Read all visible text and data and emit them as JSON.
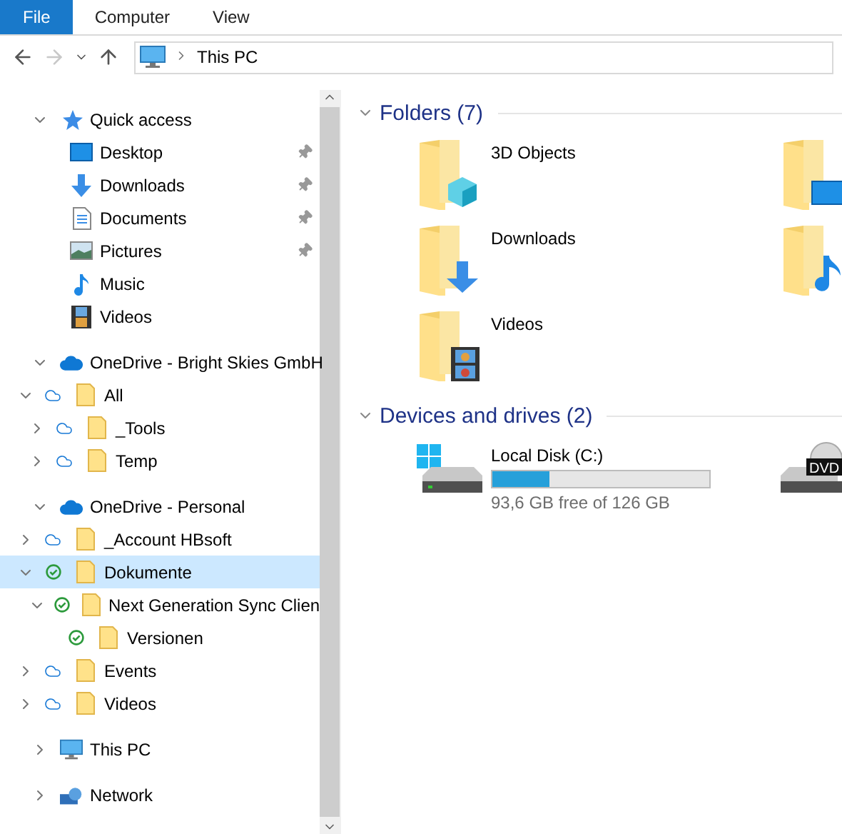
{
  "ribbon_tabs": [
    {
      "label": "File",
      "selected": true
    },
    {
      "label": "Computer",
      "selected": false
    },
    {
      "label": "View",
      "selected": false
    }
  ],
  "address": {
    "path": [
      "This PC"
    ]
  },
  "nav": [
    {
      "label": "Quick access",
      "kind": "star",
      "expanded": true,
      "selected": false,
      "children": [
        {
          "label": "Desktop",
          "kind": "desktop",
          "pinned": true,
          "selected": false
        },
        {
          "label": "Downloads",
          "kind": "download",
          "pinned": true,
          "selected": false
        },
        {
          "label": "Documents",
          "kind": "document",
          "pinned": true,
          "selected": false
        },
        {
          "label": "Pictures",
          "kind": "picture",
          "pinned": true,
          "selected": false
        },
        {
          "label": "Music",
          "kind": "music",
          "pinned": false,
          "selected": false
        },
        {
          "label": "Videos",
          "kind": "video",
          "pinned": false,
          "selected": false
        }
      ]
    },
    {
      "label": "OneDrive - Bright Skies GmbH",
      "kind": "onedrive",
      "expanded": true,
      "selected": false,
      "children": [
        {
          "label": "All",
          "kind": "cloud",
          "expanded": true,
          "selected": false,
          "children": [
            {
              "label": "_Tools",
              "kind": "cloud",
              "expanded": false,
              "selected": false
            },
            {
              "label": "Temp",
              "kind": "cloud",
              "expanded": false,
              "selected": false
            }
          ]
        }
      ]
    },
    {
      "label": "OneDrive - Personal",
      "kind": "onedrive",
      "expanded": true,
      "selected": false,
      "children": [
        {
          "label": "_Account HBsoft",
          "kind": "cloud",
          "expanded": false,
          "selected": false
        },
        {
          "label": "Dokumente",
          "kind": "synced",
          "expanded": true,
          "selected": true,
          "children": [
            {
              "label": "Next Generation Sync Clien",
              "kind": "synced",
              "expanded": true,
              "selected": false,
              "children": [
                {
                  "label": "Versionen",
                  "kind": "synced",
                  "selected": false
                }
              ]
            }
          ]
        },
        {
          "label": "Events",
          "kind": "cloud",
          "expanded": false,
          "selected": false
        },
        {
          "label": "Videos",
          "kind": "cloud",
          "expanded": false,
          "selected": false
        }
      ]
    },
    {
      "label": "This PC",
      "kind": "pc",
      "expanded": false,
      "selected": false
    },
    {
      "label": "Network",
      "kind": "network",
      "expanded": false,
      "selected": false
    }
  ],
  "sections": [
    {
      "title": "Folders (7)",
      "kind": "folders",
      "expanded": true,
      "items": [
        {
          "kind": "cube",
          "label": "3D Objects"
        },
        {
          "kind": "desktop"
        },
        {
          "kind": "download",
          "label": "Downloads"
        },
        {
          "kind": "music"
        },
        {
          "kind": "video",
          "label": "Videos"
        }
      ]
    },
    {
      "title": "Devices and drives (2)",
      "kind": "drives",
      "expanded": true,
      "items": [
        {
          "kind": "disk",
          "label": "Local Disk (C:)",
          "level": 0.26,
          "free": "93,6 GB free of 126 GB"
        },
        {
          "kind": "dvd",
          "badge": "DVD"
        }
      ]
    }
  ]
}
